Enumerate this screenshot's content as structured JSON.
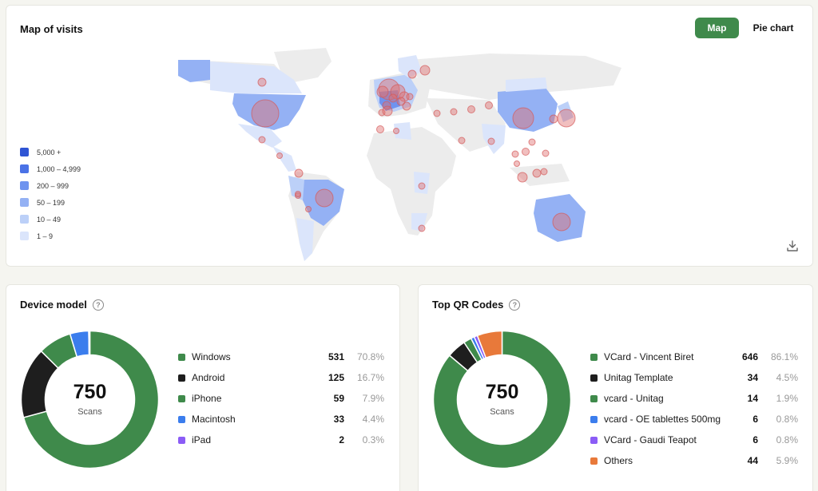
{
  "map_panel": {
    "title": "Map of visits",
    "toggle": {
      "map_label": "Map",
      "pie_label": "Pie chart",
      "active": "Map"
    },
    "legend": [
      {
        "label": "5,000 +",
        "color": "#2f55d4"
      },
      {
        "label": "1,000 – 4,999",
        "color": "#4a72e6"
      },
      {
        "label": "200 – 999",
        "color": "#6e93ef"
      },
      {
        "label": "50 – 199",
        "color": "#94b1f4"
      },
      {
        "label": "10 – 49",
        "color": "#bcd0f8"
      },
      {
        "label": "1 – 9",
        "color": "#dbe5fb"
      }
    ],
    "download_icon": "download-icon"
  },
  "device_panel": {
    "title": "Device model",
    "help_icon": "?",
    "total": "750",
    "total_label": "Scans",
    "items": [
      {
        "name": "Windows",
        "count": "531",
        "pct": "70.8%",
        "value": 531,
        "color": "#3f8a4b"
      },
      {
        "name": "Android",
        "count": "125",
        "pct": "16.7%",
        "value": 125,
        "color": "#1e1e1e"
      },
      {
        "name": "iPhone",
        "count": "59",
        "pct": "7.9%",
        "value": 59,
        "color": "#3f8a4b"
      },
      {
        "name": "Macintosh",
        "count": "33",
        "pct": "4.4%",
        "value": 33,
        "color": "#3b7ded"
      },
      {
        "name": "iPad",
        "count": "2",
        "pct": "0.3%",
        "value": 2,
        "color": "#8b5cf6"
      }
    ]
  },
  "qr_panel": {
    "title": "Top QR Codes",
    "help_icon": "?",
    "total": "750",
    "total_label": "Scans",
    "items": [
      {
        "name": "VCard - Vincent Biret",
        "count": "646",
        "pct": "86.1%",
        "value": 646,
        "color": "#3f8a4b"
      },
      {
        "name": "Unitag Template",
        "count": "34",
        "pct": "4.5%",
        "value": 34,
        "color": "#1e1e1e"
      },
      {
        "name": "vcard - Unitag",
        "count": "14",
        "pct": "1.9%",
        "value": 14,
        "color": "#3f8a4b"
      },
      {
        "name": "vcard - OE tablettes 500mg",
        "count": "6",
        "pct": "0.8%",
        "value": 6,
        "color": "#3b7ded"
      },
      {
        "name": "VCard - Gaudi Teapot",
        "count": "6",
        "pct": "0.8%",
        "value": 6,
        "color": "#8b5cf6"
      },
      {
        "name": "Others",
        "count": "44",
        "pct": "5.9%",
        "value": 44,
        "color": "#e8793a"
      }
    ]
  }
}
